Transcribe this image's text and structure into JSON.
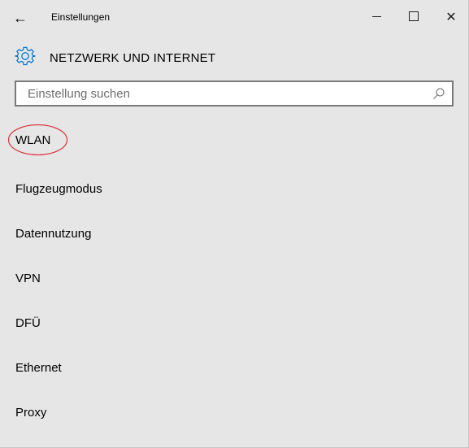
{
  "window": {
    "title": "Einstellungen",
    "controls": {
      "back": "←",
      "close": "✕"
    }
  },
  "header": {
    "icon": "gear-icon",
    "title": "NETZWERK UND INTERNET"
  },
  "search": {
    "placeholder": "Einstellung suchen",
    "value": "",
    "icon": "search-icon"
  },
  "menu": {
    "items": [
      {
        "label": "WLAN",
        "highlighted": true
      },
      {
        "label": "Flugzeugmodus"
      },
      {
        "label": "Datennutzung"
      },
      {
        "label": "VPN"
      },
      {
        "label": "DFÜ"
      },
      {
        "label": "Ethernet"
      },
      {
        "label": "Proxy"
      }
    ]
  },
  "colors": {
    "background": "#e6e6e6",
    "accent": "#0078d7",
    "highlight_oval": "#d9363e"
  }
}
